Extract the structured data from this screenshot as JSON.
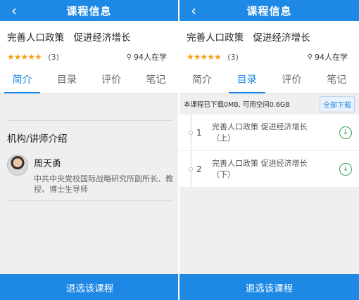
{
  "left": {
    "header": {
      "title": "课程信息",
      "back_icon": "back-chevron-icon"
    },
    "course": {
      "title": "完善人口政策　促进经济增长",
      "stars": "★★★★★",
      "rating_count": "(3)",
      "learners": "94人在学"
    },
    "tabs": [
      {
        "label": "简介",
        "active": true
      },
      {
        "label": "目录",
        "active": false
      },
      {
        "label": "评价",
        "active": false
      },
      {
        "label": "笔记",
        "active": false
      }
    ],
    "intro": {
      "heading": "机构/讲师介绍",
      "teacher_name": "周天勇",
      "teacher_desc": "中共中央党校国际战略研究所副所长、教授、博士生导师"
    },
    "bottom_button": "退选该课程"
  },
  "right": {
    "header": {
      "title": "课程信息",
      "back_icon": "back-chevron-icon"
    },
    "course": {
      "title": "完善人口政策　促进经济增长",
      "stars": "★★★★★",
      "rating_count": "(3)",
      "learners": "94人在学"
    },
    "tabs": [
      {
        "label": "简介",
        "active": false
      },
      {
        "label": "目录",
        "active": true
      },
      {
        "label": "评价",
        "active": false
      },
      {
        "label": "笔记",
        "active": false
      }
    ],
    "storage_text": "本课程已下载0MB, 可用空间0.6GB",
    "download_all": "全部下载",
    "chapters": [
      {
        "index": "1",
        "name": "完善人口政策 促进经济增长（上）"
      },
      {
        "index": "2",
        "name": "完善人口政策 促进经济增长（下）"
      }
    ],
    "bottom_button": "退选该课程"
  },
  "colors": {
    "primary": "#1e88e5",
    "star": "#f6a21a",
    "download_green": "#2ea44f"
  }
}
